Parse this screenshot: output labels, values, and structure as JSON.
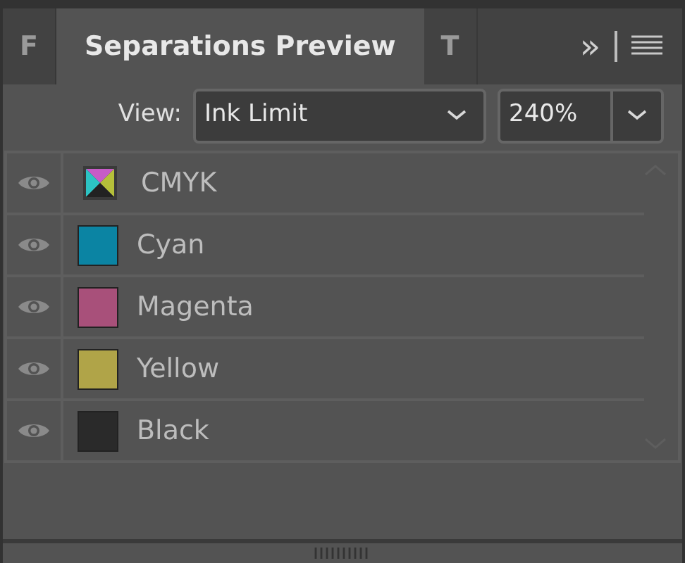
{
  "tabs": [
    {
      "label": "F",
      "selected": false
    },
    {
      "label": "Separations Preview",
      "selected": true
    },
    {
      "label": "T",
      "selected": false
    }
  ],
  "overflow": "»",
  "view": {
    "label": "View:",
    "value": "Ink Limit"
  },
  "limit": {
    "value": "240%"
  },
  "separations": [
    {
      "kind": "composite",
      "name": "CMYK",
      "visible": true
    },
    {
      "kind": "ink",
      "name": "Cyan",
      "color": "#0b84a3",
      "visible": true
    },
    {
      "kind": "ink",
      "name": "Magenta",
      "color": "#a8507a",
      "visible": true
    },
    {
      "kind": "ink",
      "name": "Yellow",
      "color": "#b0a448",
      "visible": true
    },
    {
      "kind": "ink",
      "name": "Black",
      "color": "#2a2a2a",
      "visible": true
    }
  ]
}
